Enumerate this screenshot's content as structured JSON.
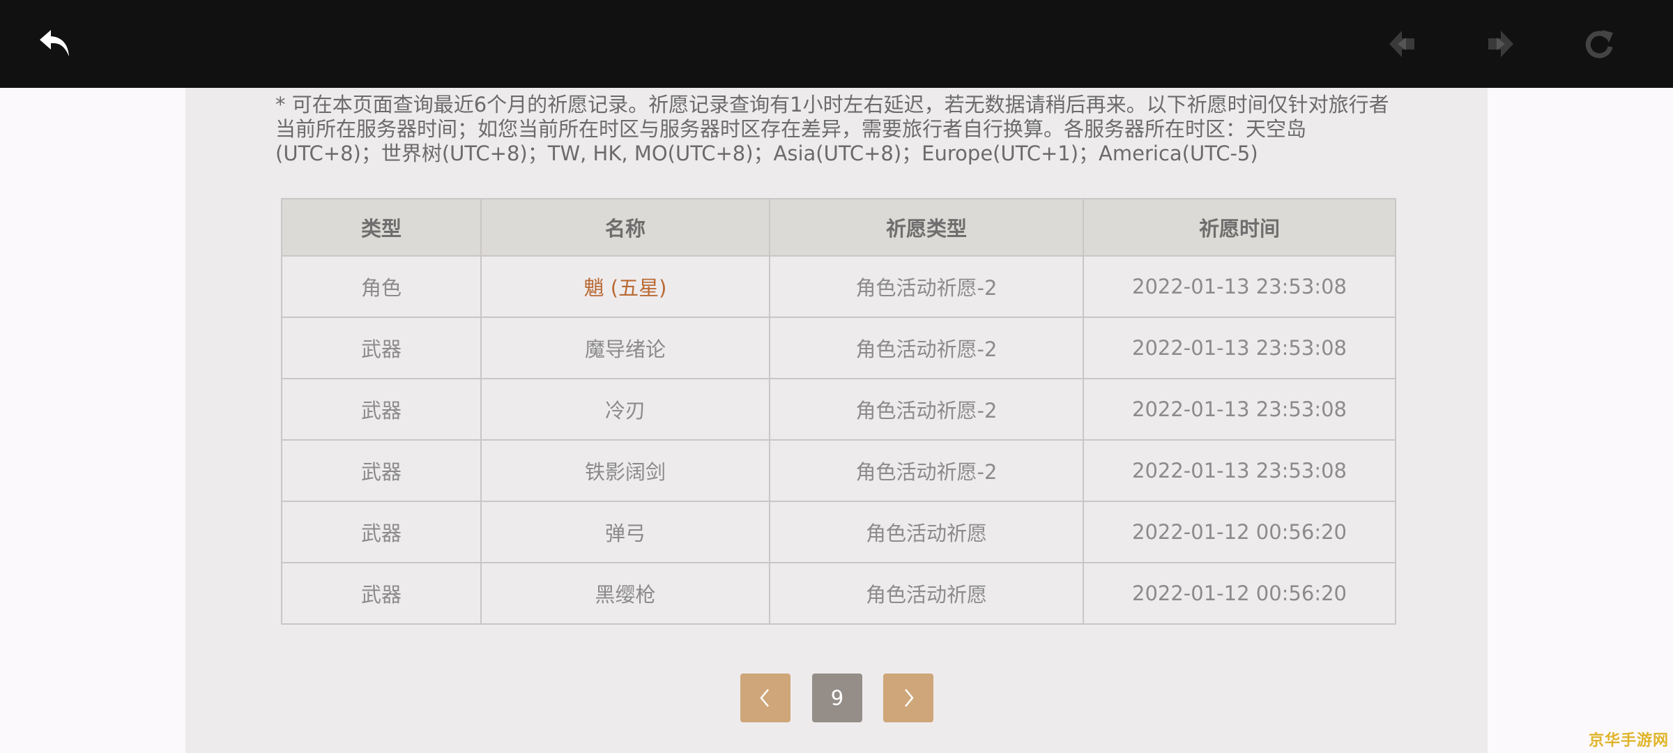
{
  "topbar": {
    "back_icon": "back-arrow-icon",
    "prev_icon": "prev-page-icon",
    "next_icon": "next-page-icon",
    "refresh_icon": "refresh-icon"
  },
  "notice": {
    "text": "* 可在本页面查询最近6个月的祈愿记录。祈愿记录查询有1小时左右延迟，若无数据请稍后再来。以下祈愿时间仅针对旅行者当前所在服务器时间；如您当前所在时区与服务器时区存在差异，需要旅行者自行换算。各服务器所在时区：天空岛(UTC+8)；世界树(UTC+8)；TW, HK, MO(UTC+8)；Asia(UTC+8)；Europe(UTC+1)；America(UTC-5)"
  },
  "table": {
    "headers": [
      "类型",
      "名称",
      "祈愿类型",
      "祈愿时间"
    ],
    "rows": [
      {
        "type": "角色",
        "name": "魈 (五星)",
        "wish": "角色活动祈愿-2",
        "time": "2022-01-13 23:53:08"
      },
      {
        "type": "武器",
        "name": "魔导绪论",
        "wish": "角色活动祈愿-2",
        "time": "2022-01-13 23:53:08"
      },
      {
        "type": "武器",
        "name": "冷刃",
        "wish": "角色活动祈愿-2",
        "time": "2022-01-13 23:53:08"
      },
      {
        "type": "武器",
        "name": "铁影阔剑",
        "wish": "角色活动祈愿-2",
        "time": "2022-01-13 23:53:08"
      },
      {
        "type": "武器",
        "name": "弹弓",
        "wish": "角色活动祈愿",
        "time": "2022-01-12 00:56:20"
      },
      {
        "type": "武器",
        "name": "黑缨枪",
        "wish": "角色活动祈愿",
        "time": "2022-01-12 00:56:20"
      }
    ]
  },
  "pagination": {
    "current_page": "9",
    "prev_icon": "chevron-left-icon",
    "next_icon": "chevron-right-icon"
  },
  "watermark": {
    "text": "京华手游网"
  },
  "colors": {
    "topbar": "#111111",
    "five_star": "#b96a33",
    "pager_button": "#cfa679",
    "pager_current": "#958e88"
  }
}
